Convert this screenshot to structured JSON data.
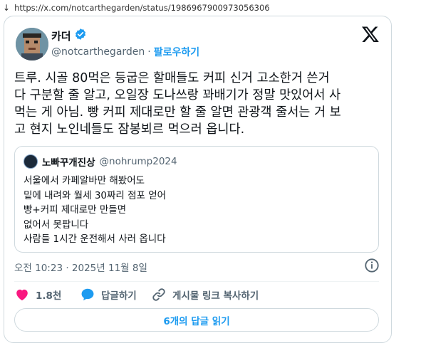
{
  "browser": {
    "back_arrow": "↓",
    "url": "https://x.com/notcarthegarden/status/1986967900973056306"
  },
  "tweet": {
    "author_name": "카더",
    "verified": true,
    "handle": "@notcarthegarden",
    "separator": "·",
    "follow_label": "팔로우하기",
    "text": "트루. 시골 80먹은 등굽은 할매들도 커피 신거 고소한거 쓴거\n다 구분할 줄 알고, 오일장 도나쓰랑 꽈배기가 정말 맛있어서 사\n먹는 게 아님. 빵 커피 제대로만 할 줄 알면 관광객 줄서는 거 보\n고 현지 노인네들도 잠봉뵈르 먹으러 옵니다.",
    "timestamp": "오전 10:23 · 2025년 11월 8일",
    "icons": {
      "x_logo": "x-logo-icon",
      "verified": "verified-badge-icon",
      "info": "info-icon",
      "like": "heart-icon",
      "reply": "speech-bubble-icon",
      "link": "link-icon"
    },
    "colors": {
      "accent": "#1d9bf0",
      "like": "#f91880",
      "text": "#0f1419",
      "muted": "#536471",
      "border": "#cfd9de"
    }
  },
  "quote": {
    "author_name": "노빠꾸개진상",
    "handle": "@nohrump2024",
    "lines": [
      "서울에서 카페알바만 해봤어도",
      "밑에 내려와 월세 30짜리 점포 얻어",
      "빵+커피 제대로만 만들면",
      "없어서 못팝니다",
      "사람들 1시간 운전해서 사러 옵니다"
    ]
  },
  "actions": {
    "like_count": "1.8천",
    "reply_label": "답글하기",
    "copy_link_label": "게시물 링크 복사하기"
  },
  "replies_button": {
    "label": "6개의 답글 읽기"
  }
}
